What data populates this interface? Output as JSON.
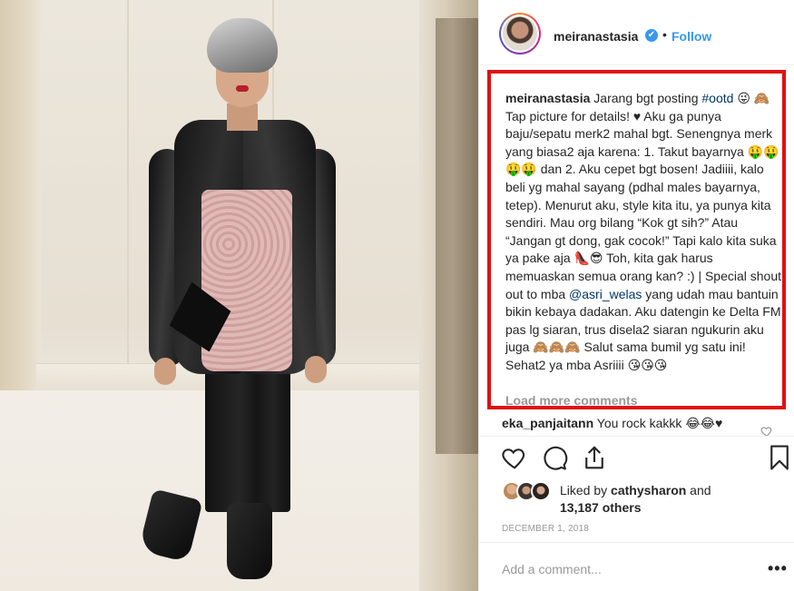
{
  "post": {
    "username": "meiranastasia",
    "verified_mark": "✔",
    "separator": "•",
    "follow_label": "Follow"
  },
  "caption": {
    "username": "meiranastasia",
    "part1": " Jarang bgt posting ",
    "hashtag": "#ootd",
    "part2": " 😜 🙈 Tap picture for details! ♥ Aku ga punya baju/sepatu merk2 mahal bgt. Senengnya merk yang biasa2 aja karena: 1. Takut bayarnya 🤑🤑🤑🤑 dan 2. Aku cepet bgt bosen! Jadiiii, kalo beli yg mahal sayang (pdhal males bayarnya, tetep). Menurut aku, style kita itu, ya punya kita sendiri. Mau org bilang “Kok gt sih?” Atau “Jangan gt dong, gak cocok!” Tapi kalo kita suka ya pake aja 👠😎 Toh, kita gak harus memuaskan semua orang kan? :) | Special shout out to mba ",
    "mention": "@asri_welas",
    "part3": " yang udah mau bantuin bikin kebaya dadakan. Aku datengin ke Delta FM pas lg siaran, trus disela2 siaran ngukurin aku juga 🙈🙈🙈 Salut sama bumil yg satu ini! Sehat2 ya mba Asriiii 😘😘😘"
  },
  "load_more_label": "Load more comments",
  "comment": {
    "username": "eka_panjaitann",
    "text": " You rock kakkk 😂😂♥"
  },
  "likes": {
    "prefix": "Liked by ",
    "user": "cathysharon",
    "middle": " and",
    "count": "13,187 others"
  },
  "date": "DECEMBER 1, 2018",
  "add_comment_placeholder": "Add a comment...",
  "more_options": "•••",
  "icons": [
    "heart-icon",
    "comment-icon",
    "share-icon",
    "bookmark-icon",
    "verified-icon"
  ],
  "colors": {
    "accent": "#3897f0",
    "highlight_border": "#e01010",
    "link": "#003569",
    "muted": "#999999"
  }
}
